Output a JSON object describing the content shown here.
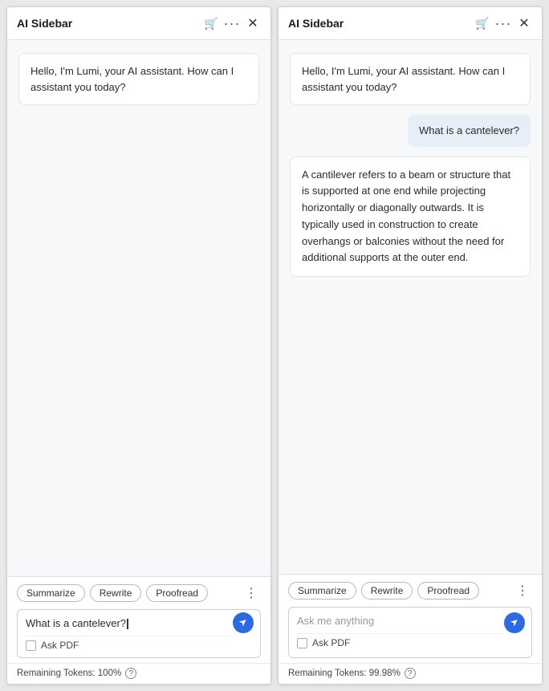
{
  "panels": [
    {
      "id": "panel-left",
      "title": "AI Sidebar",
      "messages": [
        {
          "type": "bot",
          "text": "Hello, I'm Lumi, your AI assistant. How can I assistant you today?"
        }
      ],
      "chips": [
        "Summarize",
        "Rewrite",
        "Proofread"
      ],
      "input_value": "What is a cantelever?",
      "input_placeholder": "Ask me anything",
      "ask_pdf_label": "Ask PDF",
      "tokens_label": "Remaining Tokens: 100%",
      "has_cursor": true
    },
    {
      "id": "panel-right",
      "title": "AI Sidebar",
      "messages": [
        {
          "type": "bot",
          "text": "Hello, I'm Lumi, your AI assistant. How can I assistant you today?"
        },
        {
          "type": "user",
          "text": "What is a cantelever?"
        },
        {
          "type": "bot-response",
          "text": "A cantilever refers to a beam or structure that is supported at one end while projecting horizontally or diagonally outwards. It is typically used in construction to create overhangs or balconies without the need for additional supports at the outer end."
        }
      ],
      "chips": [
        "Summarize",
        "Rewrite",
        "Proofread"
      ],
      "input_value": "",
      "input_placeholder": "Ask me anything",
      "ask_pdf_label": "Ask PDF",
      "tokens_label": "Remaining Tokens: 99.98%",
      "has_cursor": false
    }
  ],
  "icons": {
    "cart": "🛒",
    "more": "···",
    "close": "✕",
    "send": "➤",
    "mic": "■",
    "help": "?"
  }
}
